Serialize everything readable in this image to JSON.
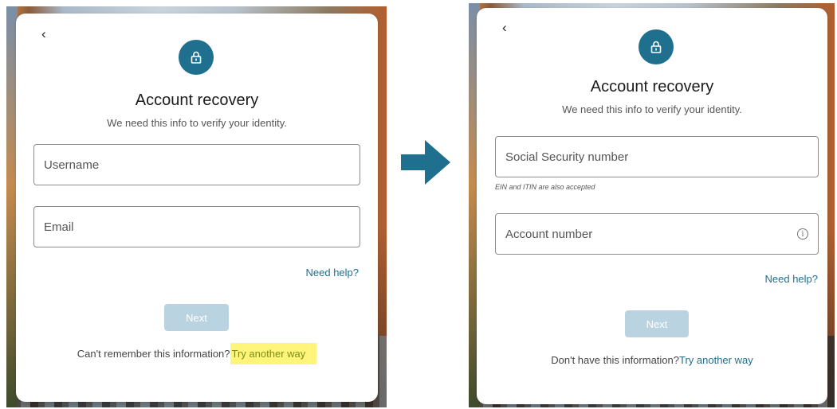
{
  "left_screen": {
    "back_glyph": "‹",
    "title": "Account recovery",
    "subtitle": "We need this info to verify your identity.",
    "fields": [
      {
        "placeholder": "Username"
      },
      {
        "placeholder": "Email"
      }
    ],
    "help_link": "Need help?",
    "next_button": "Next",
    "footer_text": "Can't remember this information?",
    "footer_link": "Try another way"
  },
  "right_screen": {
    "back_glyph": "‹",
    "title": "Account recovery",
    "subtitle": "We need this info to verify your identity.",
    "fields": [
      {
        "placeholder": "Social Security number"
      },
      {
        "placeholder": "Account number"
      }
    ],
    "ssn_hint": "EIN and ITIN are also accepted",
    "info_glyph": "i",
    "help_link": "Need help?",
    "next_button": "Next",
    "footer_text": "Don't have this information?",
    "footer_link": "Try another way"
  },
  "colors": {
    "accent": "#1f6f8f",
    "button_disabled": "#b9d4e0",
    "highlight": "#fef57a",
    "arrow": "#1f6f8f"
  },
  "icons": {
    "lock": "lock-icon",
    "arrow": "arrow-right-icon",
    "info": "info-icon",
    "back": "chevron-left-icon"
  }
}
